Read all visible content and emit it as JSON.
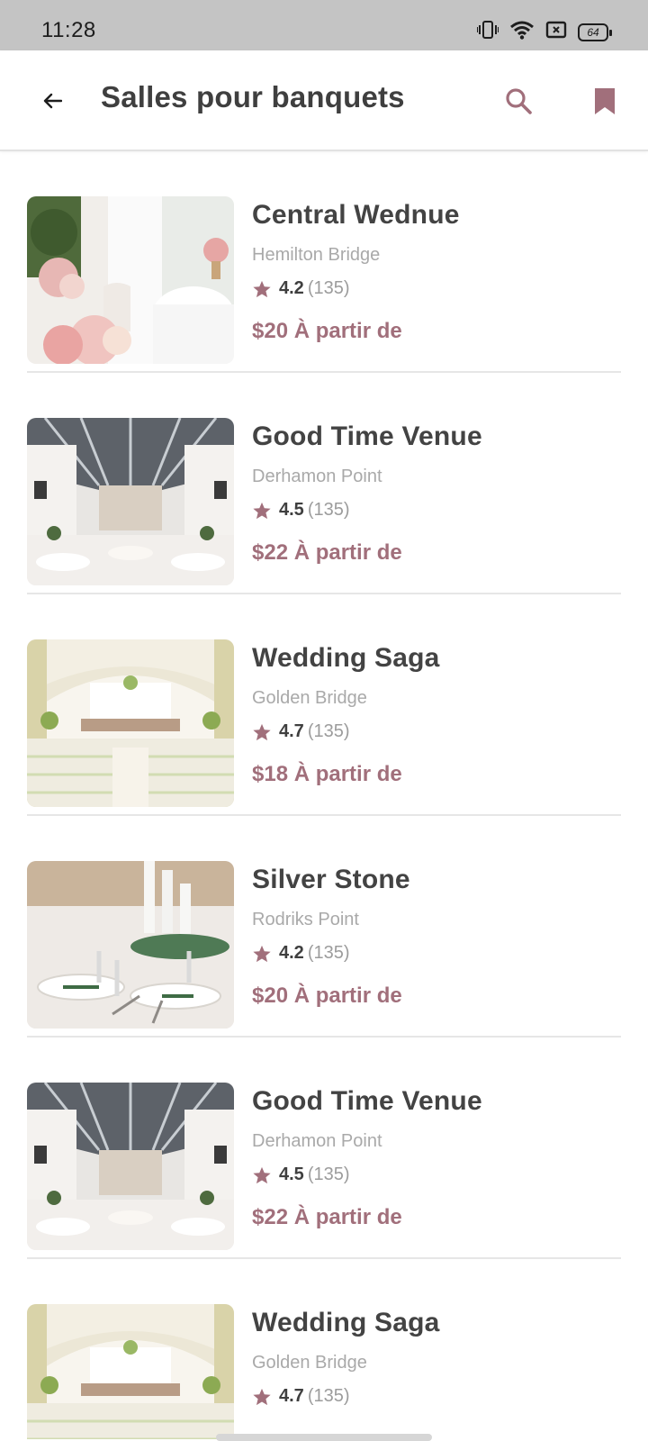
{
  "status_bar": {
    "time": "11:28",
    "battery": "64",
    "icons": [
      "vibrate-icon",
      "wifi-icon",
      "sim-off-icon",
      "battery-icon"
    ]
  },
  "app_bar": {
    "title": "Salles pour banquets",
    "icons": [
      "back-arrow-icon",
      "search-icon",
      "bookmark-icon"
    ]
  },
  "colors": {
    "accent": "#a16f7b",
    "title_text": "#3f3f3f",
    "muted_text": "#a9a9a9",
    "status_bar_bg": "#c4c4c4"
  },
  "venues": [
    {
      "name": "Central Wednue",
      "location": "Hemilton Bridge",
      "rating": "4.2",
      "reviews": "(135)",
      "price": "$20 À partir de",
      "image": "banquet-table-flowers"
    },
    {
      "name": "Good Time Venue",
      "location": "Derhamon Point",
      "rating": "4.5",
      "reviews": "(135)",
      "price": "$22 À partir de",
      "image": "glass-roof-hall"
    },
    {
      "name": "Wedding Saga",
      "location": "Golden Bridge",
      "rating": "4.7",
      "reviews": "(135)",
      "price": "$18 À partir de",
      "image": "arched-ceremony-hall"
    },
    {
      "name": "Silver Stone",
      "location": "Rodriks Point",
      "rating": "4.2",
      "reviews": "(135)",
      "price": "$20 À partir de",
      "image": "table-setting-candles"
    },
    {
      "name": "Good Time Venue",
      "location": "Derhamon Point",
      "rating": "4.5",
      "reviews": "(135)",
      "price": "$22 À partir de",
      "image": "glass-roof-hall"
    },
    {
      "name": "Wedding Saga",
      "location": "Golden Bridge",
      "rating": "4.7",
      "reviews": "(135)",
      "price": "",
      "image": "arched-ceremony-hall"
    }
  ]
}
